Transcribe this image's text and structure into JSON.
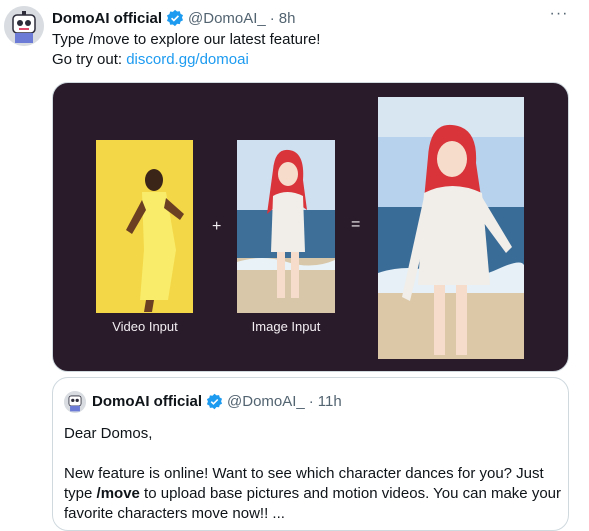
{
  "tweet": {
    "author_name": "DomoAI official",
    "handle": "@DomoAI_",
    "separator": "·",
    "time": "8h",
    "more_label": "···",
    "line1": "Type /move to explore our latest feature!",
    "line2_prefix": "Go try out:",
    "link": "discord.gg/domoai"
  },
  "media": {
    "label_video": "Video Input",
    "label_image": "Image Input",
    "plus": "+",
    "equals": "=",
    "colors": {
      "background": "#2a1b2a",
      "video_bg": "#f2d33a",
      "sky": "#9fc3e6",
      "sea": "#3e6f99",
      "hair": "#d9343a"
    }
  },
  "quote": {
    "author_name": "DomoAI official",
    "handle": "@DomoAI_",
    "separator": "·",
    "time": "11h",
    "greeting": "Dear Domos,",
    "body_part1": "New feature is online! Want to see which character dances for you? Just type ",
    "body_bold": "/move",
    "body_part2": " to upload base pictures and motion videos. You can make your favorite characters move now!! ..."
  },
  "colors": {
    "accent": "#1d9bf0",
    "secondary_text": "#536471",
    "border": "#cfd9de"
  },
  "icons": {
    "verified": "verified-badge-icon",
    "more": "more-horizontal-icon",
    "avatar": "robot-avatar"
  }
}
